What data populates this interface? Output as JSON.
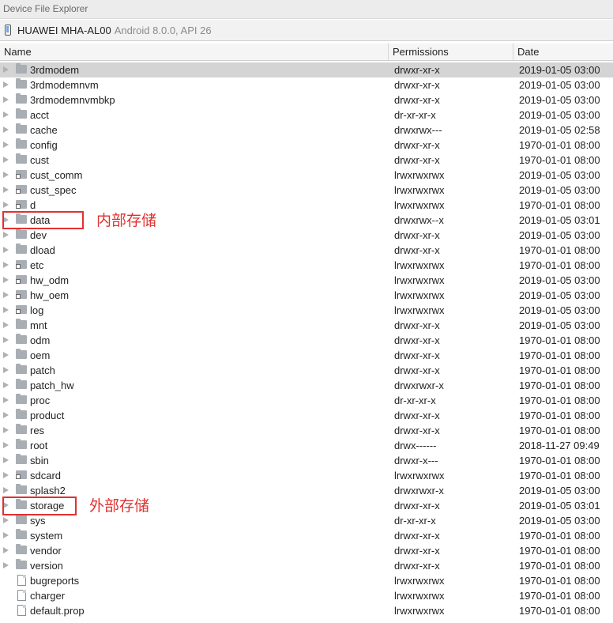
{
  "window": {
    "title": "Device File Explorer"
  },
  "device": {
    "name": "HUAWEI MHA-AL00",
    "version": "Android 8.0.0, API 26"
  },
  "columns": {
    "name": "Name",
    "permissions": "Permissions",
    "date": "Date"
  },
  "rows": [
    {
      "name": "3rdmodem",
      "perm": "drwxr-xr-x",
      "date": "2019-01-05 03:00",
      "type": "folder",
      "expandable": true,
      "selected": true
    },
    {
      "name": "3rdmodemnvm",
      "perm": "drwxr-xr-x",
      "date": "2019-01-05 03:00",
      "type": "folder",
      "expandable": true
    },
    {
      "name": "3rdmodemnvmbkp",
      "perm": "drwxr-xr-x",
      "date": "2019-01-05 03:00",
      "type": "folder",
      "expandable": true
    },
    {
      "name": "acct",
      "perm": "dr-xr-xr-x",
      "date": "2019-01-05 03:00",
      "type": "folder",
      "expandable": true
    },
    {
      "name": "cache",
      "perm": "drwxrwx---",
      "date": "2019-01-05 02:58",
      "type": "folder",
      "expandable": true
    },
    {
      "name": "config",
      "perm": "drwxr-xr-x",
      "date": "1970-01-01 08:00",
      "type": "folder",
      "expandable": true
    },
    {
      "name": "cust",
      "perm": "drwxr-xr-x",
      "date": "1970-01-01 08:00",
      "type": "folder",
      "expandable": true
    },
    {
      "name": "cust_comm",
      "perm": "lrwxrwxrwx",
      "date": "2019-01-05 03:00",
      "type": "link",
      "expandable": true
    },
    {
      "name": "cust_spec",
      "perm": "lrwxrwxrwx",
      "date": "2019-01-05 03:00",
      "type": "link",
      "expandable": true
    },
    {
      "name": "d",
      "perm": "lrwxrwxrwx",
      "date": "1970-01-01 08:00",
      "type": "link",
      "expandable": true
    },
    {
      "name": "data",
      "perm": "drwxrwx--x",
      "date": "2019-01-05 03:01",
      "type": "folder",
      "expandable": true
    },
    {
      "name": "dev",
      "perm": "drwxr-xr-x",
      "date": "2019-01-05 03:00",
      "type": "folder",
      "expandable": true
    },
    {
      "name": "dload",
      "perm": "drwxr-xr-x",
      "date": "1970-01-01 08:00",
      "type": "folder",
      "expandable": true
    },
    {
      "name": "etc",
      "perm": "lrwxrwxrwx",
      "date": "1970-01-01 08:00",
      "type": "link",
      "expandable": true
    },
    {
      "name": "hw_odm",
      "perm": "lrwxrwxrwx",
      "date": "2019-01-05 03:00",
      "type": "link",
      "expandable": true
    },
    {
      "name": "hw_oem",
      "perm": "lrwxrwxrwx",
      "date": "2019-01-05 03:00",
      "type": "link",
      "expandable": true
    },
    {
      "name": "log",
      "perm": "lrwxrwxrwx",
      "date": "2019-01-05 03:00",
      "type": "link",
      "expandable": true
    },
    {
      "name": "mnt",
      "perm": "drwxr-xr-x",
      "date": "2019-01-05 03:00",
      "type": "folder",
      "expandable": true
    },
    {
      "name": "odm",
      "perm": "drwxr-xr-x",
      "date": "1970-01-01 08:00",
      "type": "folder",
      "expandable": true
    },
    {
      "name": "oem",
      "perm": "drwxr-xr-x",
      "date": "1970-01-01 08:00",
      "type": "folder",
      "expandable": true
    },
    {
      "name": "patch",
      "perm": "drwxr-xr-x",
      "date": "1970-01-01 08:00",
      "type": "folder",
      "expandable": true
    },
    {
      "name": "patch_hw",
      "perm": "drwxrwxr-x",
      "date": "1970-01-01 08:00",
      "type": "folder",
      "expandable": true
    },
    {
      "name": "proc",
      "perm": "dr-xr-xr-x",
      "date": "1970-01-01 08:00",
      "type": "folder",
      "expandable": true
    },
    {
      "name": "product",
      "perm": "drwxr-xr-x",
      "date": "1970-01-01 08:00",
      "type": "folder",
      "expandable": true
    },
    {
      "name": "res",
      "perm": "drwxr-xr-x",
      "date": "1970-01-01 08:00",
      "type": "folder",
      "expandable": true
    },
    {
      "name": "root",
      "perm": "drwx------",
      "date": "2018-11-27 09:49",
      "type": "folder",
      "expandable": true
    },
    {
      "name": "sbin",
      "perm": "drwxr-x---",
      "date": "1970-01-01 08:00",
      "type": "folder",
      "expandable": true
    },
    {
      "name": "sdcard",
      "perm": "lrwxrwxrwx",
      "date": "1970-01-01 08:00",
      "type": "link",
      "expandable": true
    },
    {
      "name": "splash2",
      "perm": "drwxrwxr-x",
      "date": "2019-01-05 03:00",
      "type": "folder",
      "expandable": true
    },
    {
      "name": "storage",
      "perm": "drwxr-xr-x",
      "date": "2019-01-05 03:01",
      "type": "folder",
      "expandable": true
    },
    {
      "name": "sys",
      "perm": "dr-xr-xr-x",
      "date": "2019-01-05 03:00",
      "type": "folder",
      "expandable": true
    },
    {
      "name": "system",
      "perm": "drwxr-xr-x",
      "date": "1970-01-01 08:00",
      "type": "folder",
      "expandable": true
    },
    {
      "name": "vendor",
      "perm": "drwxr-xr-x",
      "date": "1970-01-01 08:00",
      "type": "folder",
      "expandable": true
    },
    {
      "name": "version",
      "perm": "drwxr-xr-x",
      "date": "1970-01-01 08:00",
      "type": "folder",
      "expandable": true
    },
    {
      "name": "bugreports",
      "perm": "lrwxrwxrwx",
      "date": "1970-01-01 08:00",
      "type": "file",
      "expandable": false
    },
    {
      "name": "charger",
      "perm": "lrwxrwxrwx",
      "date": "1970-01-01 08:00",
      "type": "file",
      "expandable": false
    },
    {
      "name": "default.prop",
      "perm": "lrwxrwxrwx",
      "date": "1970-01-01 08:00",
      "type": "file",
      "expandable": false
    }
  ],
  "annotations": [
    {
      "row": 10,
      "label": "内部存储"
    },
    {
      "row": 29,
      "label": "外部存储"
    }
  ],
  "colors": {
    "annotation": "#e0312f",
    "selected_row": "#d4d4d4",
    "folder_icon": "#a9aeb4"
  }
}
